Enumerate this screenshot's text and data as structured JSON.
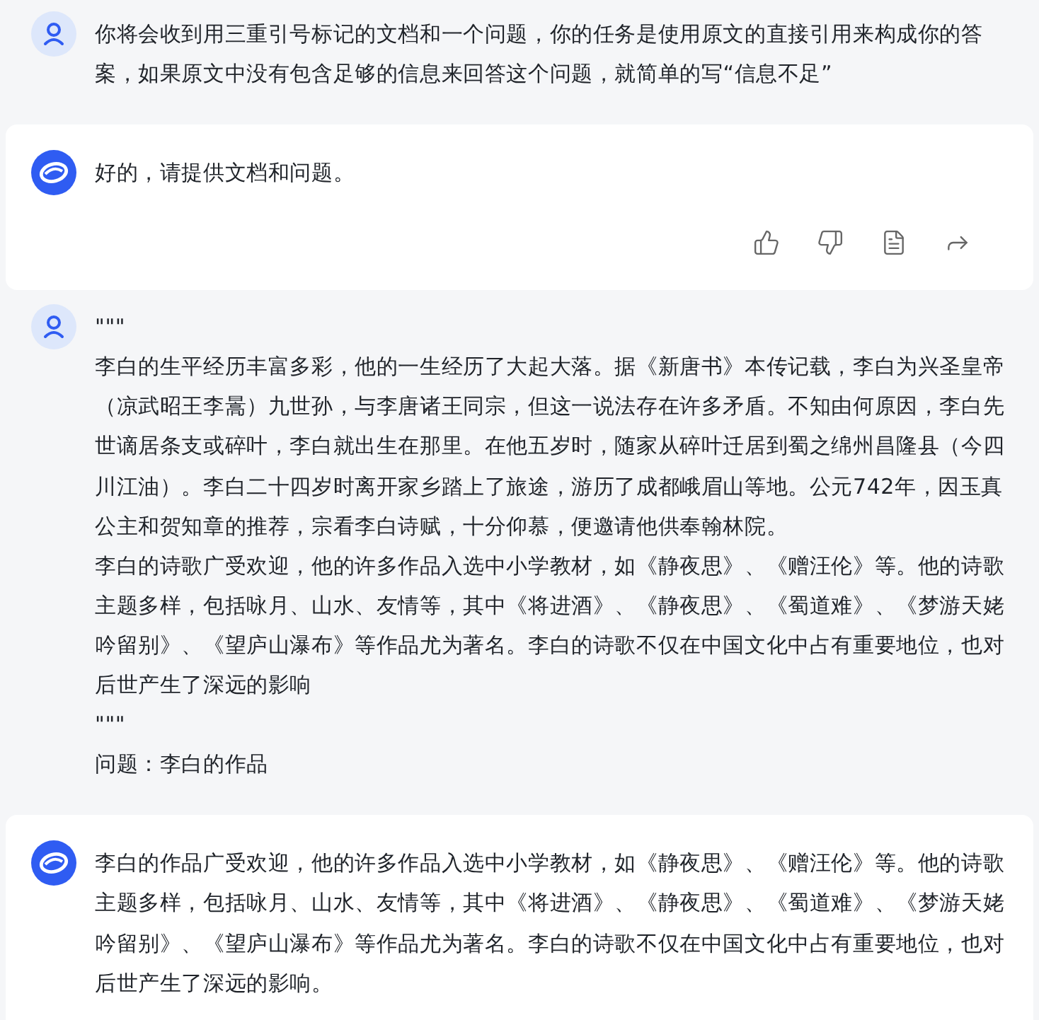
{
  "messages": [
    {
      "kind": "user",
      "paragraphs": [
        "你将会收到用三重引号标记的文档和一个问题，你的任务是使用原文的直接引用来构成你的答案，如果原文中没有包含足够的信息来回答这个问题，就简单的写“信息不足”"
      ]
    },
    {
      "kind": "assistant",
      "paragraphs": [
        "好的，请提供文档和问题。"
      ],
      "actions": [
        {
          "kind": "like"
        },
        {
          "kind": "dislike"
        },
        {
          "kind": "copy"
        },
        {
          "kind": "share"
        }
      ]
    },
    {
      "kind": "user",
      "paragraphs": [
        "\"\"\"",
        "李白的生平经历丰富多彩，他的一生经历了大起大落。据《新唐书》本传记载，李白为兴圣皇帝（凉武昭王李暠）九世孙，与李唐诸王同宗，但这一说法存在许多矛盾。不知由何原因，李白先世谪居条支或碎叶，李白就出生在那里。在他五岁时，随家从碎叶迁居到蜀之绵州昌隆县（今四川江油）。李白二十四岁时离开家乡踏上了旅途，游历了成都峨眉山等地。公元742年，因玉真公主和贺知章的推荐，宗看李白诗赋，十分仰慕，便邀请他供奉翰林院。",
        "李白的诗歌广受欢迎，他的许多作品入选中小学教材，如《静夜思》、《赠汪伦》等。他的诗歌主题多样，包括咏月、山水、友情等，其中《将进酒》、《静夜思》、《蜀道难》、《梦游天姥吟留别》、《望庐山瀑布》等作品尤为著名。李白的诗歌不仅在中国文化中占有重要地位，也对后世产生了深远的影响",
        "\"\"\"",
        "问题：李白的作品"
      ]
    },
    {
      "kind": "assistant",
      "paragraphs": [
        "李白的作品广受欢迎，他的许多作品入选中小学教材，如《静夜思》、《赠汪伦》等。他的诗歌主题多样，包括咏月、山水、友情等，其中《将进酒》、《静夜思》、《蜀道难》、《梦游天姥吟留别》、《望庐山瀑布》等作品尤为著名。李白的诗歌不仅在中国文化中占有重要地位，也对后世产生了深远的影响。"
      ]
    }
  ]
}
